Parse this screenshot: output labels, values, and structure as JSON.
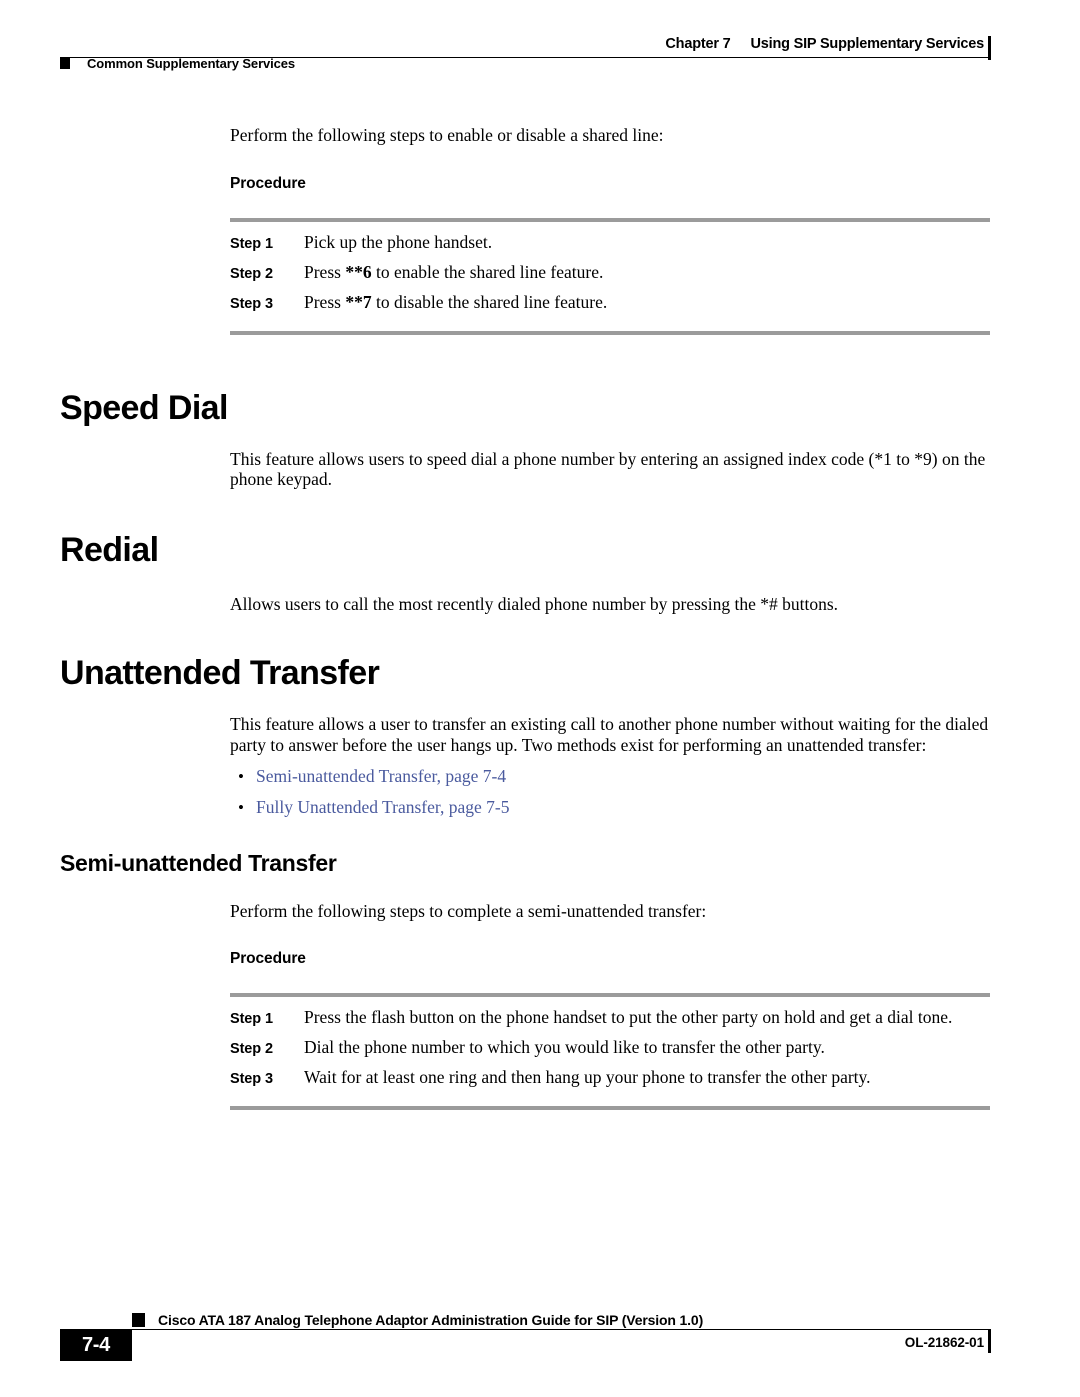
{
  "header": {
    "left_marker_icon": "black-square-marker",
    "left_text": "Common Supplementary Services",
    "chapter_label": "Chapter 7",
    "chapter_title": "Using SIP Supplementary Services"
  },
  "content": {
    "shared_line_intro": "Perform the following steps to enable or disable a shared line:",
    "procedure_label_1": "Procedure",
    "shared_line_steps": [
      {
        "label": "Step 1",
        "text_plain": "Pick up the phone handset.",
        "pre": "Pick up the phone handset.",
        "bold": "",
        "post": ""
      },
      {
        "label": "Step 2",
        "text_plain": "Press **6 to enable the shared line feature.",
        "pre": "Press ",
        "bold": "**6",
        "post": " to enable the shared line feature."
      },
      {
        "label": "Step 3",
        "text_plain": "Press **7 to disable the shared line feature.",
        "pre": "Press ",
        "bold": "**7",
        "post": " to disable the shared line feature."
      }
    ],
    "speed_dial_heading": "Speed Dial",
    "speed_dial_body": "This feature allows users to speed dial a phone number by entering an assigned index code (*1 to *9) on the phone keypad.",
    "redial_heading": "Redial",
    "redial_body": "Allows users to call the most recently dialed phone number by pressing the *# buttons.",
    "unattended_transfer_heading": "Unattended Transfer",
    "unattended_transfer_body": "This feature allows a user to transfer an existing call to another phone number without waiting for the dialed party to answer before the user hangs up. Two methods exist for performing an unattended transfer:",
    "bullet_glyph": "•",
    "cross_references": [
      "Semi-unattended Transfer, page 7-4",
      "Fully Unattended Transfer, page 7-5"
    ],
    "semi_unattended_heading": "Semi-unattended Transfer",
    "semi_unattended_intro": "Perform the following steps to complete a semi-unattended transfer:",
    "procedure_label_2": "Procedure",
    "semi_unattended_steps": [
      {
        "label": "Step 1",
        "text": "Press the flash button on the phone handset to put the other party on hold and get a dial tone."
      },
      {
        "label": "Step 2",
        "text": "Dial the phone number to which you would like to transfer the other party."
      },
      {
        "label": "Step 3",
        "text": "Wait for at least one ring and then hang up your phone to transfer the other party."
      }
    ]
  },
  "footer": {
    "page_number": "7-4",
    "marker_icon": "black-square-marker",
    "document_title": "Cisco ATA 187 Analog Telephone Adaptor Administration Guide for SIP (Version 1.0)",
    "doc_id": "OL-21862-01"
  },
  "colors": {
    "link": "#4a5a9e",
    "rule_gray": "#9b9b9b",
    "text": "#000000",
    "background": "#ffffff"
  }
}
